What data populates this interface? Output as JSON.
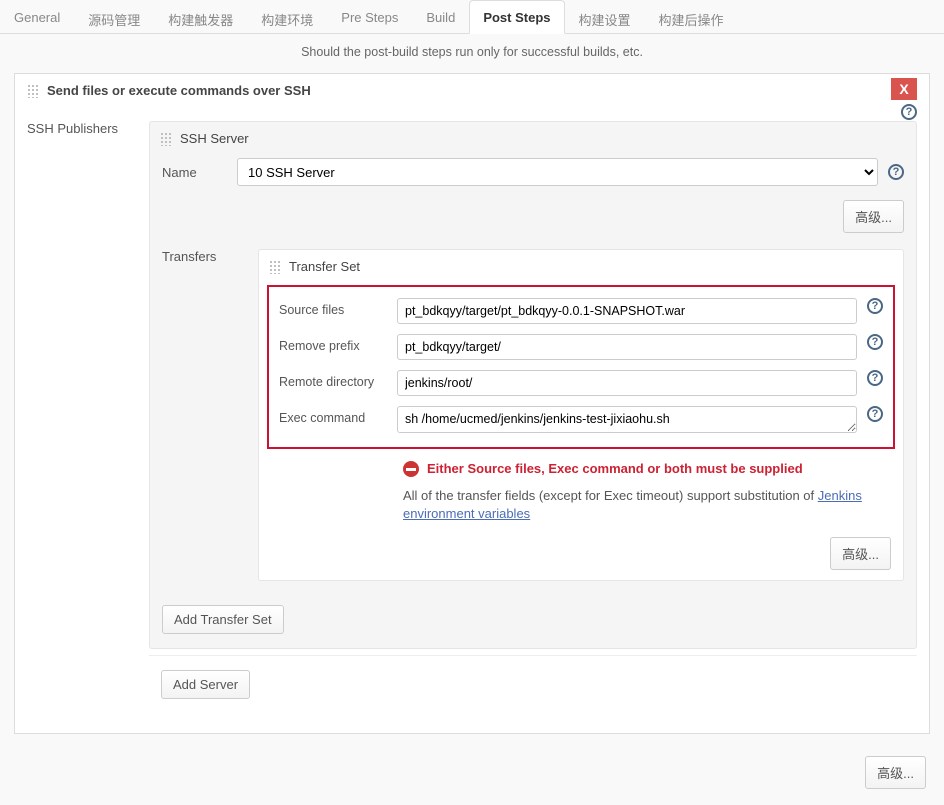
{
  "tabs": [
    "General",
    "源码管理",
    "构建触发器",
    "构建环境",
    "Pre Steps",
    "Build",
    "Post Steps",
    "构建设置",
    "构建后操作"
  ],
  "subtitle": "Should the post-build steps run only for successful builds, etc.",
  "section": {
    "title": "Send files or execute commands over SSH",
    "close": "X",
    "publishers_label": "SSH Publishers"
  },
  "ssh_server": {
    "heading": "SSH Server",
    "name_label": "Name",
    "name_value": "10 SSH Server",
    "advanced": "高级..."
  },
  "transfers": {
    "label": "Transfers",
    "set_heading": "Transfer Set",
    "fields": {
      "source_label": "Source files",
      "source_value": "pt_bdkqyy/target/pt_bdkqyy-0.0.1-SNAPSHOT.war",
      "prefix_label": "Remove prefix",
      "prefix_value": "pt_bdkqyy/target/",
      "remote_label": "Remote directory",
      "remote_value": "jenkins/root/",
      "exec_label": "Exec command",
      "exec_value": "sh /home/ucmed/jenkins/jenkins-test-jixiaohu.sh"
    },
    "error": "Either Source files, Exec command or both must be supplied",
    "info_prefix": "All of the transfer fields (except for Exec timeout) support substitution of ",
    "info_link": "Jenkins environment variables",
    "advanced": "高级...",
    "add_set": "Add Transfer Set"
  },
  "add_server": "Add Server",
  "bottom_advanced": "高级..."
}
